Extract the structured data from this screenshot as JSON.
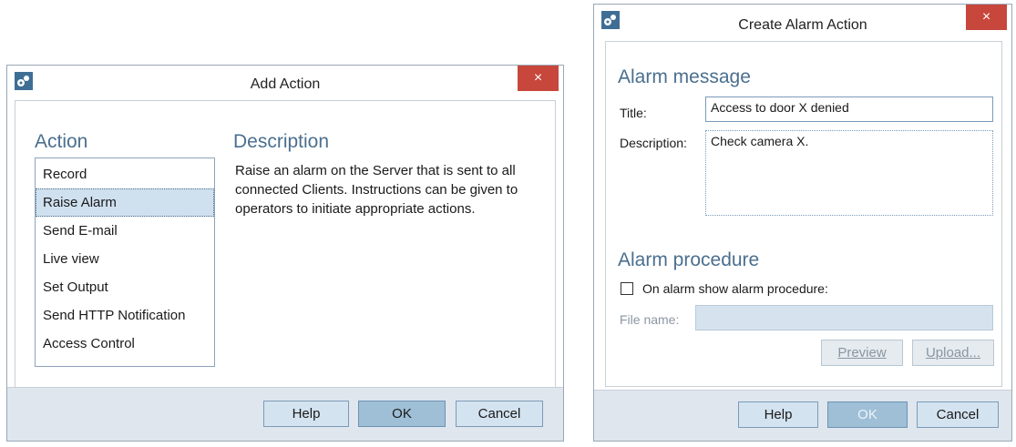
{
  "add_action": {
    "title": "Add Action",
    "close_label": "×",
    "action_heading": "Action",
    "description_heading": "Description",
    "actions": [
      "Record",
      "Raise Alarm",
      "Send E-mail",
      "Live view",
      "Set Output",
      "Send HTTP Notification",
      "Access Control"
    ],
    "selected_action": "Raise Alarm",
    "description_text": "Raise an alarm on the Server that is sent to all connected Clients. Instructions can be given to operators to initiate appropriate actions.",
    "buttons": {
      "help": "Help",
      "ok": "OK",
      "cancel": "Cancel"
    }
  },
  "create_alarm_action": {
    "title": "Create Alarm Action",
    "close_label": "×",
    "alarm_message_heading": "Alarm message",
    "title_label": "Title:",
    "title_value": "Access to door X denied",
    "description_label": "Description:",
    "description_value": "Check camera X.",
    "alarm_procedure_heading": "Alarm procedure",
    "show_procedure_label": "On alarm show alarm procedure:",
    "show_procedure_checked": false,
    "file_name_label": "File name:",
    "file_name_value": "",
    "preview_label": "Preview",
    "upload_label": "Upload...",
    "buttons": {
      "help": "Help",
      "ok": "OK",
      "cancel": "Cancel"
    }
  }
}
